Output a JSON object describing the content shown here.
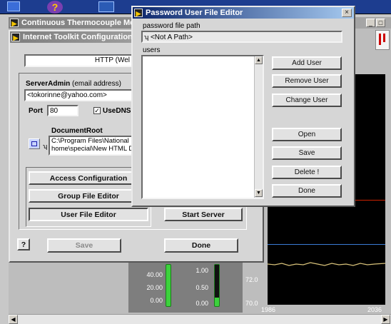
{
  "taskbar": {
    "color": "#000080"
  },
  "background_windows": [
    {
      "title": "Continuous Thermocouple Meas"
    }
  ],
  "thermo_panel": {
    "left_scale": [
      "40.00",
      "20.00",
      "0.00"
    ],
    "right_scale": [
      "1.00",
      "0.50",
      "0.00"
    ],
    "chart": {
      "y_ticks": [
        "72.0",
        "70.0"
      ],
      "x_labels": [
        "1986",
        "2036"
      ]
    }
  },
  "itk_window": {
    "title": "Internet Toolkit Configuration",
    "http_field": "HTTP (Wel",
    "serveradmin_label": "ServerAdmin",
    "serveradmin_hint": "(email address)",
    "email": "<tokorinne@yahoo.com>",
    "port_label": "Port",
    "port_value": "80",
    "usedns_label": "UseDNS",
    "usedns_checked": true,
    "documentroot_label": "DocumentRoot",
    "docroot_lines": [
      "C:\\Program Files\\National I",
      "home\\special\\New HTML Do"
    ],
    "buttons": {
      "access": "Access Configuration",
      "group": "Group File Editor",
      "user": "User File Editor",
      "start": "Start Server",
      "help": "?",
      "save": "Save",
      "done": "Done"
    }
  },
  "pwd_window": {
    "title": "Password User File Editor",
    "path_label": "password file path",
    "path_value": "<Not A Path>",
    "users_label": "users",
    "buttons": {
      "add": "Add User",
      "remove": "Remove User",
      "change": "Change User",
      "open": "Open",
      "save": "Save",
      "delete": "Delete !",
      "done": "Done"
    },
    "close_glyph": "×"
  },
  "colors": {
    "titlebar_active": "#0a246a",
    "chart_red": "#cc2200",
    "chart_blue": "#3a7bd5",
    "chart_yellow": "#d8c27a",
    "gauge_green": "#3cd23c"
  }
}
